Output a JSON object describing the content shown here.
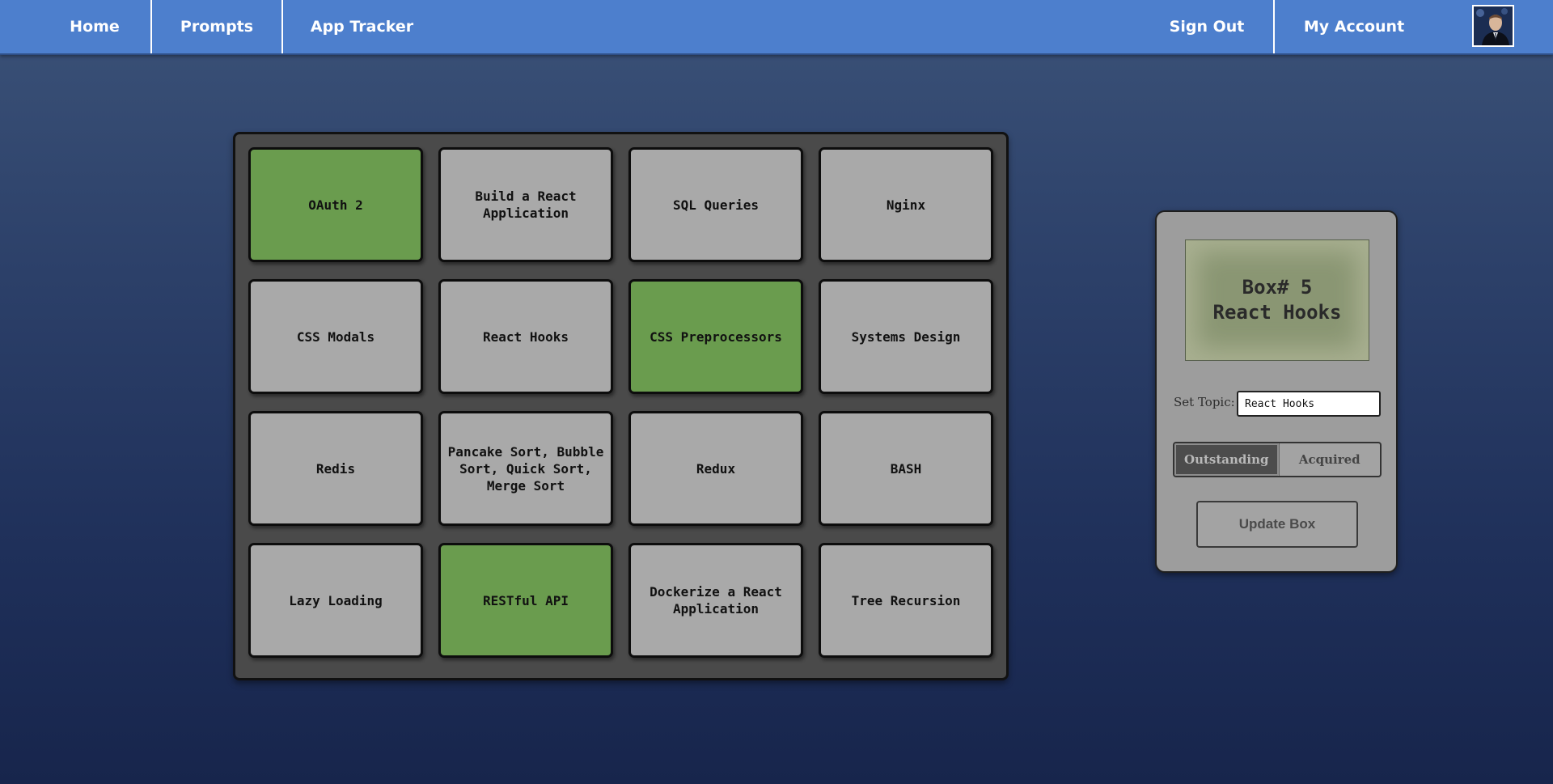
{
  "nav": {
    "home": "Home",
    "prompts": "Prompts",
    "tracker": "App Tracker",
    "sign_out": "Sign Out",
    "my_account": "My Account"
  },
  "board": {
    "tiles": [
      {
        "label": "OAuth 2",
        "status": "acquired"
      },
      {
        "label": "Build a React Application",
        "status": "outstanding"
      },
      {
        "label": "SQL Queries",
        "status": "outstanding"
      },
      {
        "label": "Nginx",
        "status": "outstanding"
      },
      {
        "label": "CSS Modals",
        "status": "outstanding"
      },
      {
        "label": "React Hooks",
        "status": "outstanding"
      },
      {
        "label": "CSS Preprocessors",
        "status": "acquired"
      },
      {
        "label": "Systems Design",
        "status": "outstanding"
      },
      {
        "label": "Redis",
        "status": "outstanding"
      },
      {
        "label": "Pancake Sort, Bubble Sort, Quick Sort, Merge Sort",
        "status": "outstanding"
      },
      {
        "label": "Redux",
        "status": "outstanding"
      },
      {
        "label": "BASH",
        "status": "outstanding"
      },
      {
        "label": "Lazy Loading",
        "status": "outstanding"
      },
      {
        "label": "RESTful API",
        "status": "acquired"
      },
      {
        "label": "Dockerize a React Application",
        "status": "outstanding"
      },
      {
        "label": "Tree Recursion",
        "status": "outstanding"
      }
    ]
  },
  "panel": {
    "box_title": "Box# 5",
    "box_topic": "React Hooks",
    "set_topic_label": "Set Topic:",
    "topic_value": "React Hooks",
    "toggle_outstanding": "Outstanding",
    "toggle_acquired": "Acquired",
    "selected_status": "outstanding",
    "update_button": "Update Box"
  },
  "colors": {
    "nav_bg": "#4d7fcd",
    "tile_default": "#a9a9a9",
    "tile_acquired": "#6a9c4e",
    "board_bg": "#4a4a4a",
    "panel_bg": "#9d9d9d"
  }
}
